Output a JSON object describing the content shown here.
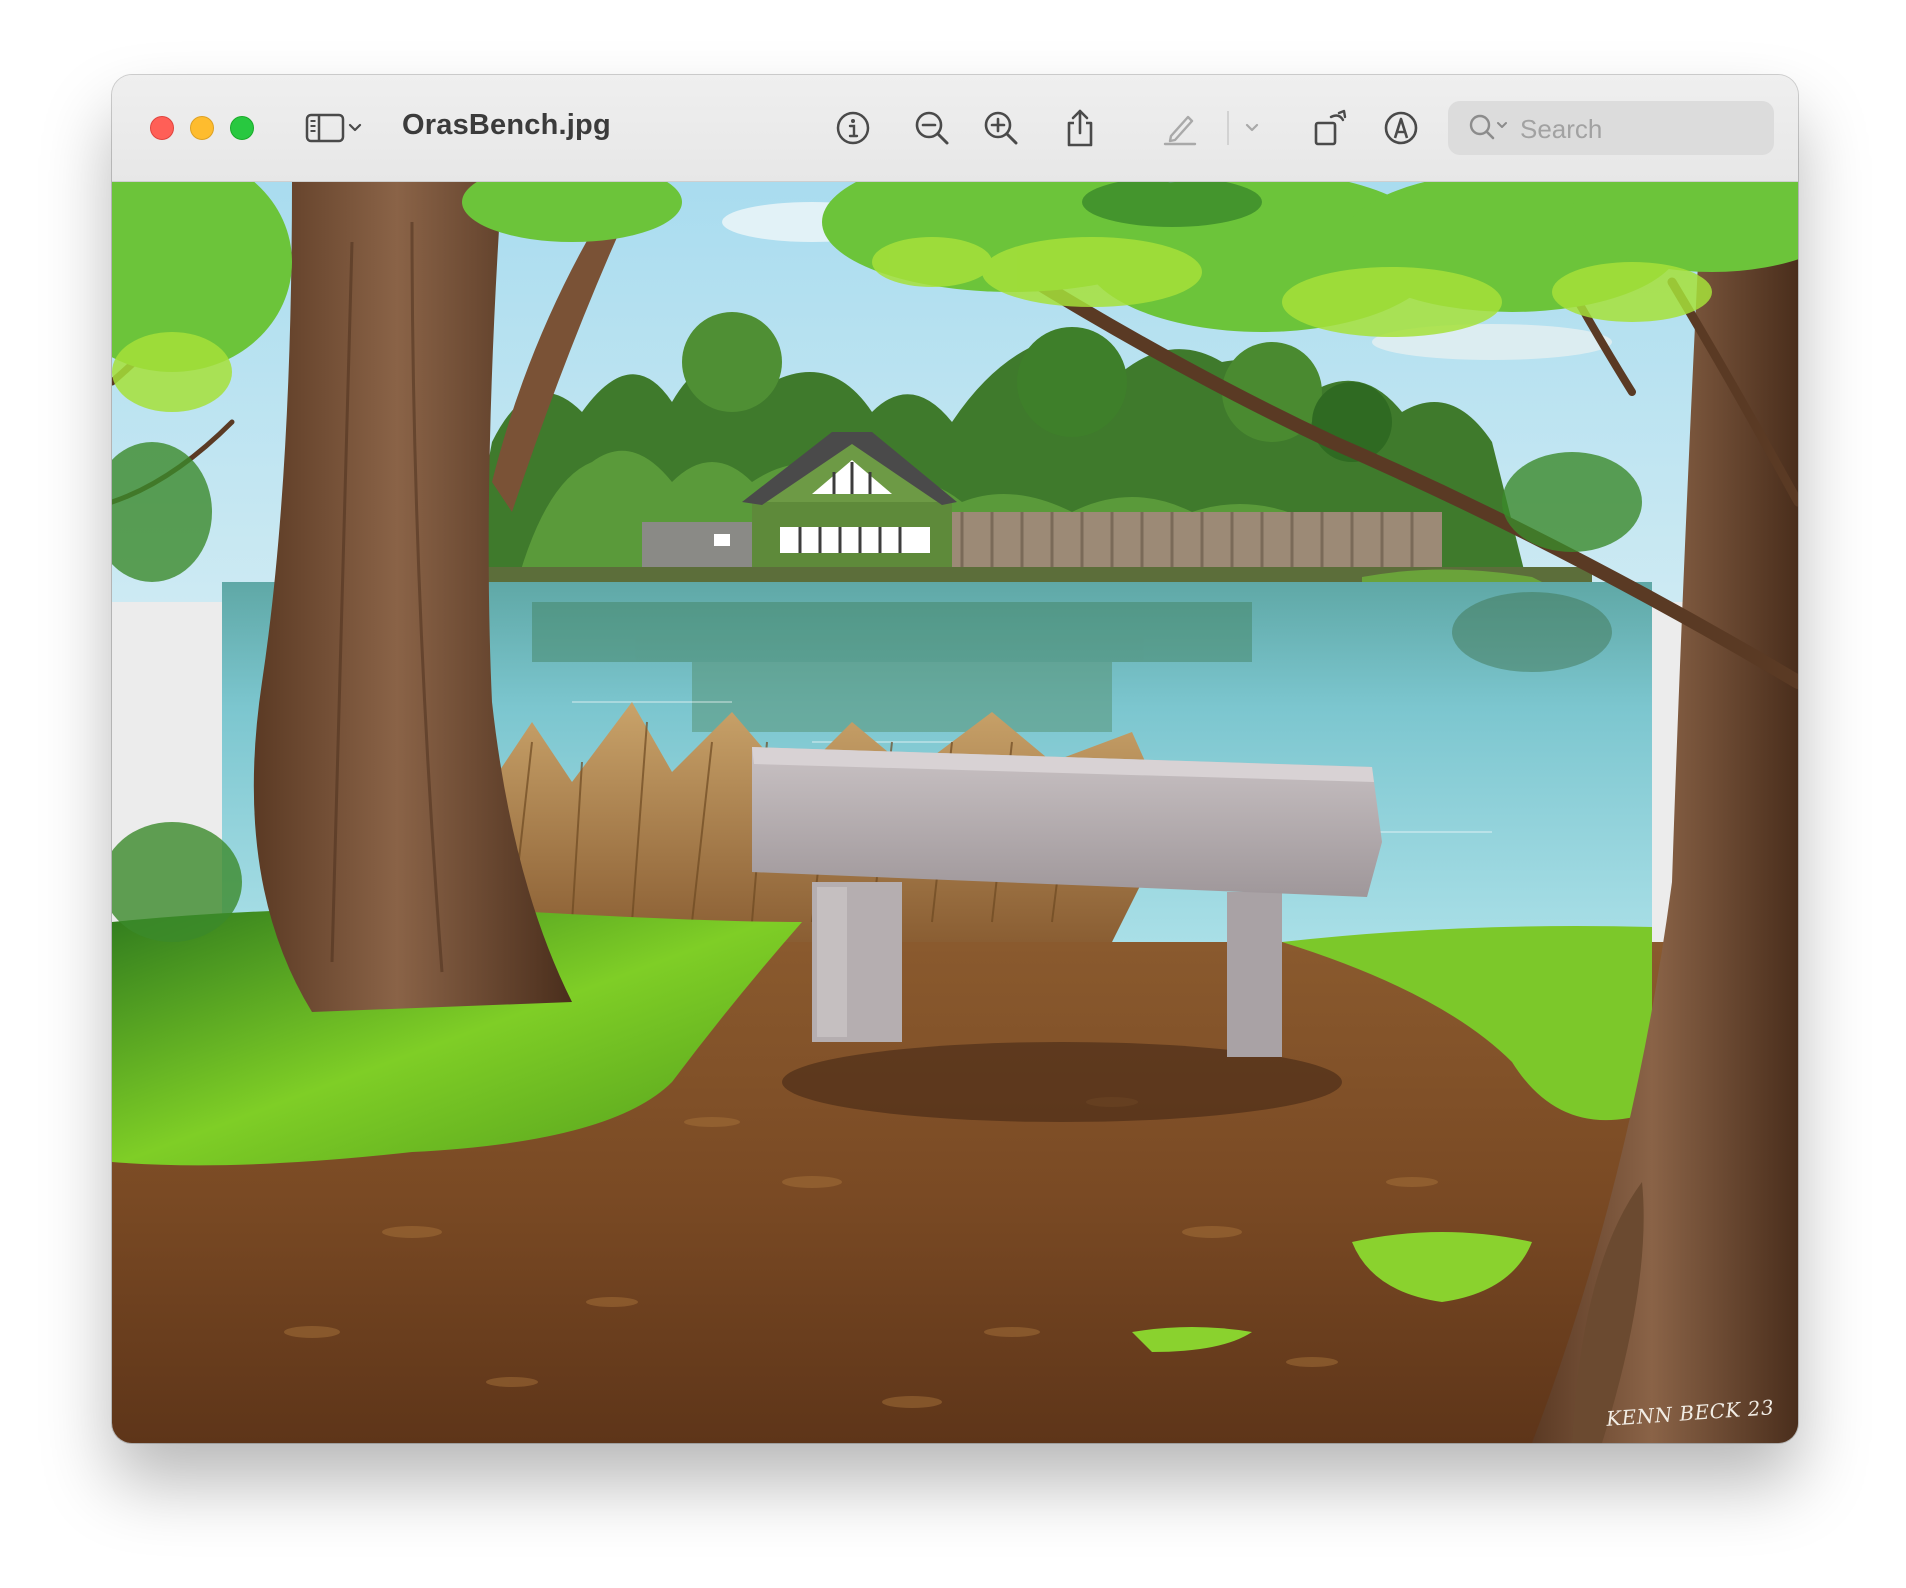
{
  "window": {
    "title": "OrasBench.jpg"
  },
  "toolbar": {
    "sidebar_toggle": "sidebar-icon",
    "sidebar_menu": "chevron-down-icon",
    "info": "info-icon",
    "zoom_out": "zoom-out-icon",
    "zoom_in": "zoom-in-icon",
    "share": "share-icon",
    "markup": "pencil-icon",
    "markup_menu": "chevron-down-icon",
    "rotate": "rotate-icon",
    "annotate": "markup-circle-icon"
  },
  "search": {
    "placeholder": "Search"
  },
  "image": {
    "filename": "OrasBench.jpg",
    "signature": "KENN BECK 23"
  },
  "colors": {
    "close": "#ff5f57",
    "minimize": "#febc2e",
    "maximize": "#28c840"
  }
}
